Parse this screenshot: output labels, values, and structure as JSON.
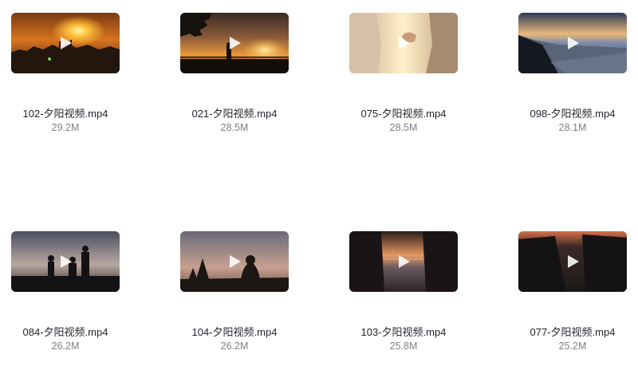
{
  "files": [
    {
      "name": "102-夕阳视频.mp4",
      "size": "29.2M"
    },
    {
      "name": "021-夕阳视频.mp4",
      "size": "28.5M"
    },
    {
      "name": "075-夕阳视频.mp4",
      "size": "28.5M"
    },
    {
      "name": "098-夕阳视频.mp4",
      "size": "28.1M"
    },
    {
      "name": "084-夕阳视频.mp4",
      "size": "26.2M"
    },
    {
      "name": "104-夕阳视频.mp4",
      "size": "26.2M"
    },
    {
      "name": "103-夕阳视频.mp4",
      "size": "25.8M"
    },
    {
      "name": "077-夕阳视频.mp4",
      "size": "25.2M"
    }
  ],
  "icons": {
    "play": "play-icon"
  }
}
